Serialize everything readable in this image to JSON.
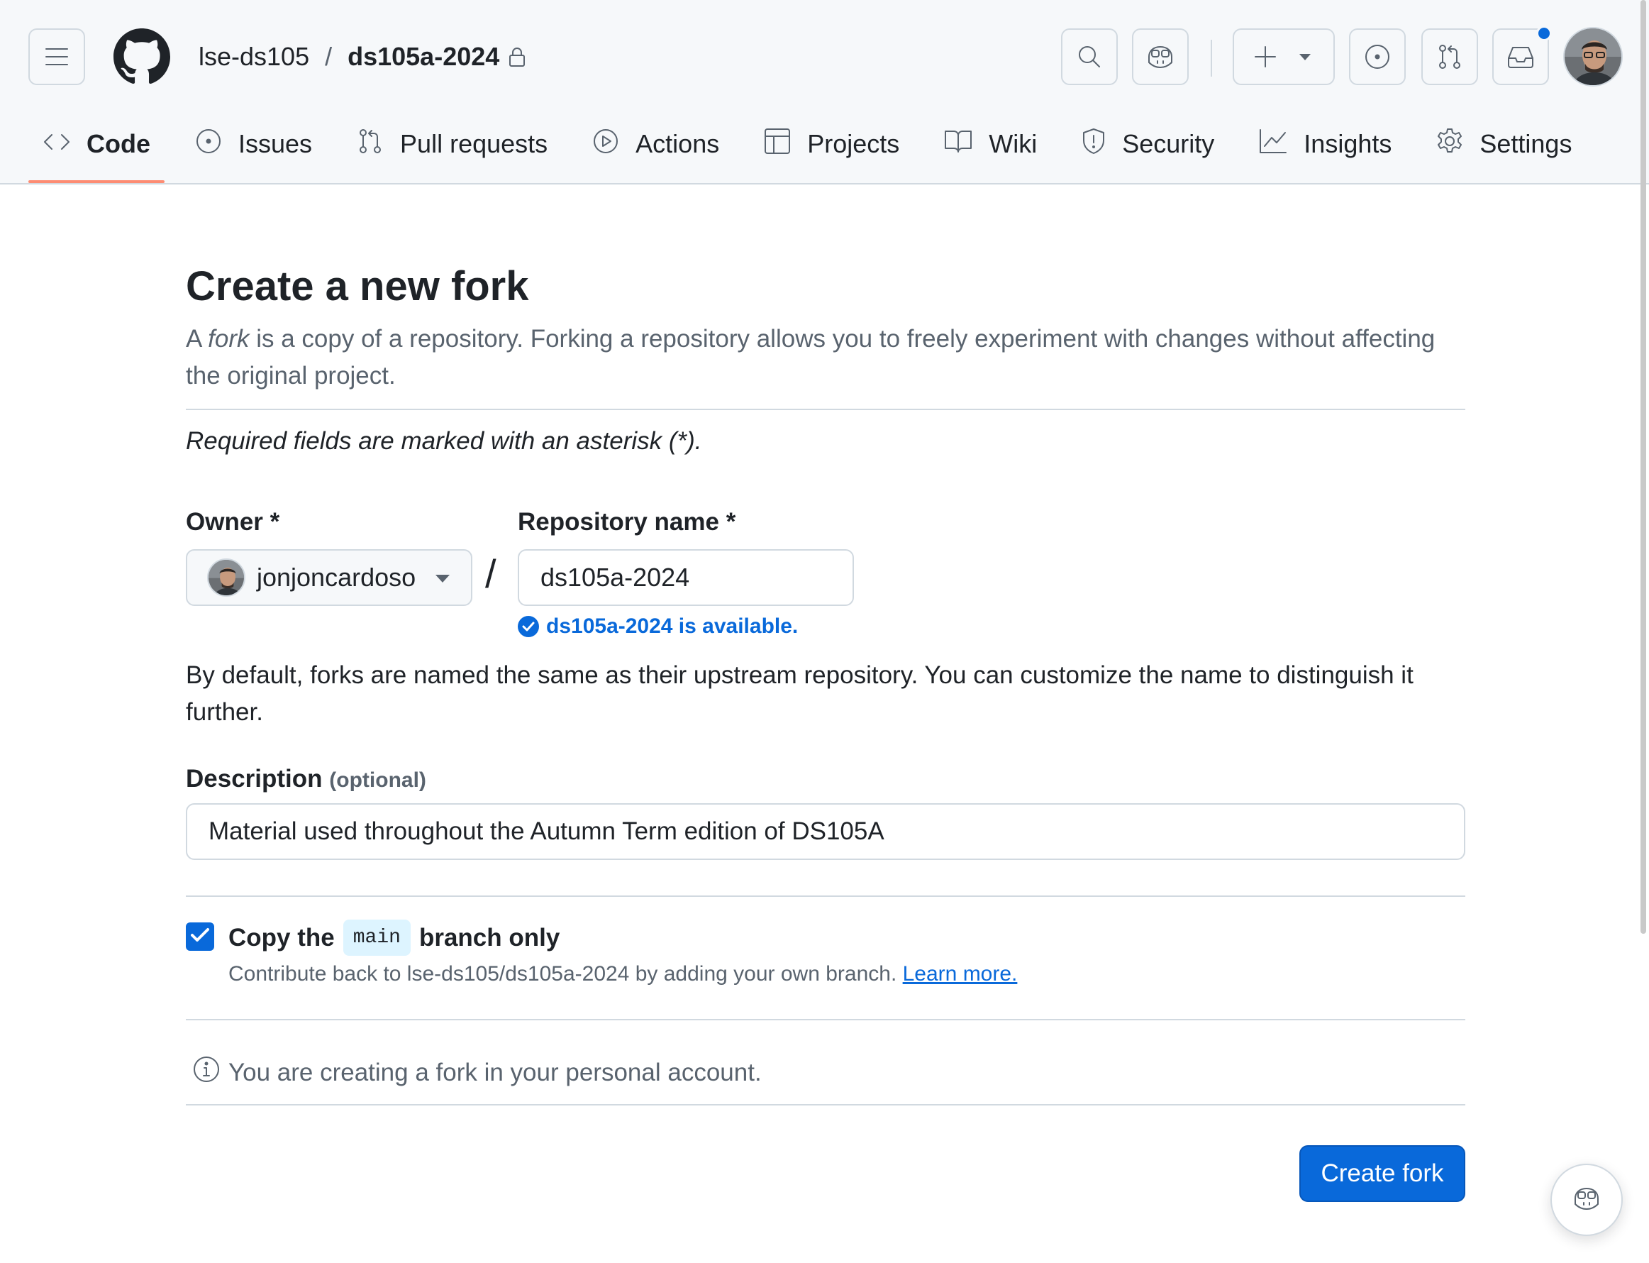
{
  "header": {
    "owner": "lse-ds105",
    "separator": "/",
    "repo": "ds105a-2024",
    "icons": [
      "menu-icon",
      "github-logo-icon",
      "lock-icon",
      "search-icon",
      "copilot-icon",
      "plus-icon",
      "chevron-down-icon",
      "issue-icon",
      "pull-request-icon",
      "inbox-icon"
    ]
  },
  "tabs": [
    {
      "label": "Code",
      "icon": "code-icon",
      "active": true
    },
    {
      "label": "Issues",
      "icon": "issue-icon"
    },
    {
      "label": "Pull requests",
      "icon": "pull-request-icon"
    },
    {
      "label": "Actions",
      "icon": "play-icon"
    },
    {
      "label": "Projects",
      "icon": "table-icon"
    },
    {
      "label": "Wiki",
      "icon": "book-icon"
    },
    {
      "label": "Security",
      "icon": "shield-icon"
    },
    {
      "label": "Insights",
      "icon": "graph-icon"
    },
    {
      "label": "Settings",
      "icon": "gear-icon"
    }
  ],
  "form": {
    "title": "Create a new fork",
    "lead_a": "A ",
    "lead_fork": "fork",
    "lead_b": " is a copy of a repository. Forking a repository allows you to freely experiment with changes without affecting the original project.",
    "required_note": "Required fields are marked with an asterisk (*).",
    "owner_label": "Owner *",
    "owner_value": "jonjoncardoso",
    "slash": "/",
    "repo_label": "Repository name *",
    "repo_value": "ds105a-2024",
    "availability": "ds105a-2024 is available.",
    "naming_help": "By default, forks are named the same as their upstream repository. You can customize the name to distinguish it further.",
    "description_label": "Description",
    "description_optional": "(optional)",
    "description_value": "Material used throughout the Autumn Term edition of DS105A",
    "copy_checked": true,
    "copy_label_a": "Copy the",
    "copy_branch": "main",
    "copy_label_b": "branch only",
    "copy_help": "Contribute back to lse-ds105/ds105a-2024 by adding your own branch.",
    "learn_more": "Learn more.",
    "info_text": "You are creating a fork in your personal account.",
    "submit": "Create fork"
  },
  "colors": {
    "accent": "#0969da",
    "tab_underline": "#fd8c73",
    "muted": "#59636e"
  }
}
